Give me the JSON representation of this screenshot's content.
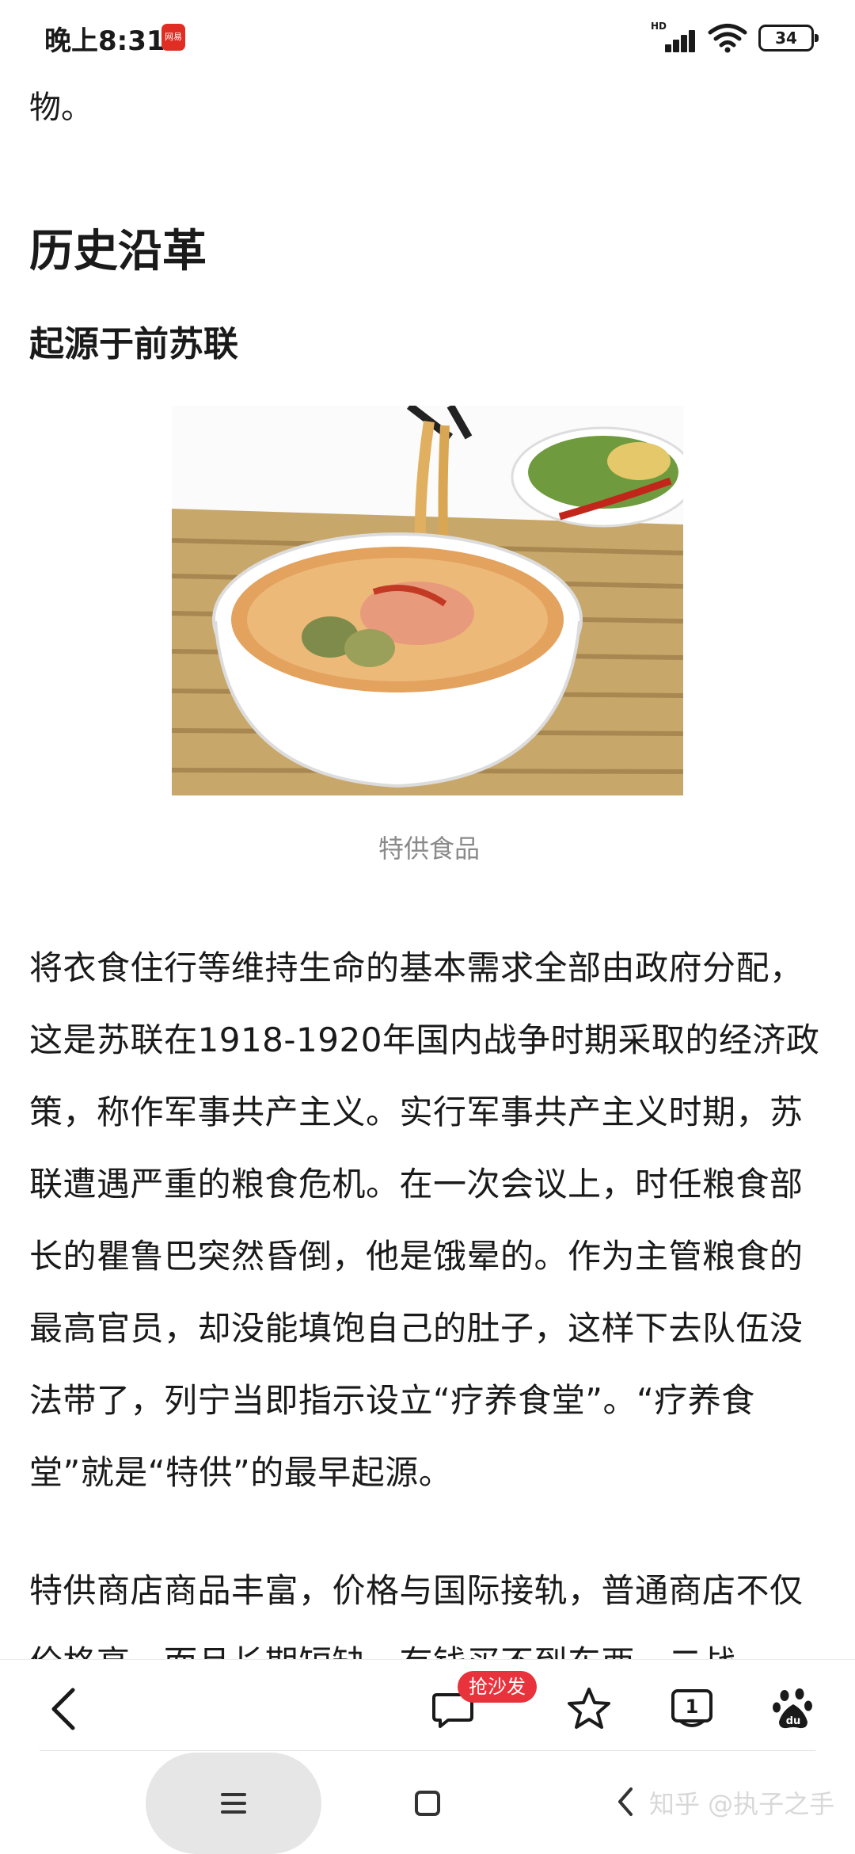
{
  "status_bar": {
    "time": "晚上8:31",
    "app_icon_label": "网易",
    "network_label": "HD",
    "battery": "34"
  },
  "article": {
    "lead_text": "物。",
    "section_title": "历史沿革",
    "subsection_title": "起源于前苏联",
    "figure_caption": "特供食品",
    "paragraphs": [
      "将衣食住行等维持生命的基本需求全部由政府分配，这是苏联在1918-1920年国内战争时期采取的经济政策，称作军事共产主义。实行军事共产主义时期，苏联遭遇严重的粮食危机。在一次会议上，时任粮食部长的瞿鲁巴突然昏倒，他是饿晕的。作为主管粮食的最高官员，却没能填饱自己的肚子，这样下去队伍没法带了，列宁当即指示设立“疗养食堂”。“疗养食堂”就是“特供”的最早起源。",
      "特供商店商品丰富，价格与国际接轨，普通商店不仅价格高，而且长期短缺，有钱买不到东西。二战"
    ]
  },
  "toolbar": {
    "sofa_badge": "抢沙发",
    "read_count": "1"
  },
  "watermark": "知乎 @执子之手",
  "colors": {
    "badge_red": "#e8323c",
    "caption_gray": "#8a8a8a",
    "nav_pill": "#e6e6e6"
  }
}
